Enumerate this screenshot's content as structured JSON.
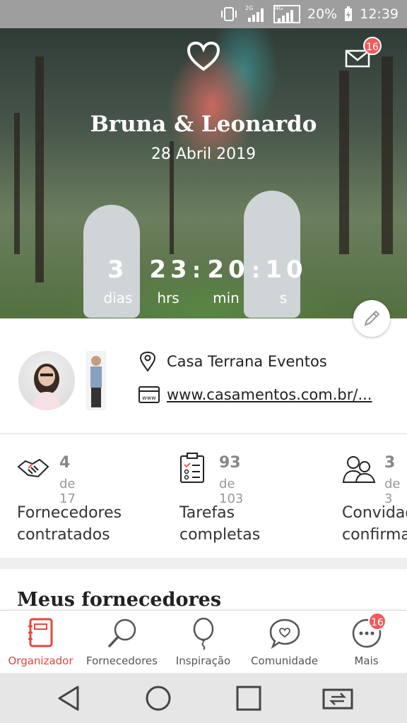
{
  "status_bar": {
    "battery": "20%",
    "time": "12:39",
    "net1": "2G",
    "net2": "4G"
  },
  "hero": {
    "couple": "Bruna & Leonardo",
    "date": "28 Abril 2019",
    "mail_badge": "16",
    "countdown": [
      {
        "value": "3",
        "label": "dias"
      },
      {
        "value": "23",
        "label": "hrs"
      },
      {
        "value": "20",
        "label": "min"
      },
      {
        "value": "10",
        "label": "s"
      }
    ]
  },
  "info": {
    "venue": "Casa Terrana Eventos",
    "website": "www.casamentos.com.br/..."
  },
  "stats": [
    {
      "count": "4",
      "of": "de 17",
      "line1": "Fornecedores",
      "line2": "contratados",
      "icon": "handshake-icon"
    },
    {
      "count": "93",
      "of": "de 103",
      "line1": "Tarefas",
      "line2": "completas",
      "icon": "clipboard-icon"
    },
    {
      "count": "3",
      "of": "de 3",
      "line1": "Convidados",
      "line2": "confirmados",
      "icon": "guests-icon"
    }
  ],
  "section_title": "Meus fornecedores",
  "tabs": [
    {
      "label": "Organizador",
      "icon": "notebook-icon",
      "active": true
    },
    {
      "label": "Fornecedores",
      "icon": "magnifier-icon"
    },
    {
      "label": "Inspiração",
      "icon": "balloon-icon"
    },
    {
      "label": "Comunidade",
      "icon": "chat-heart-icon"
    },
    {
      "label": "Mais",
      "icon": "more-icon",
      "badge": "16"
    }
  ],
  "colors": {
    "accent": "#e0483f",
    "badge": "#ef5b5b"
  }
}
